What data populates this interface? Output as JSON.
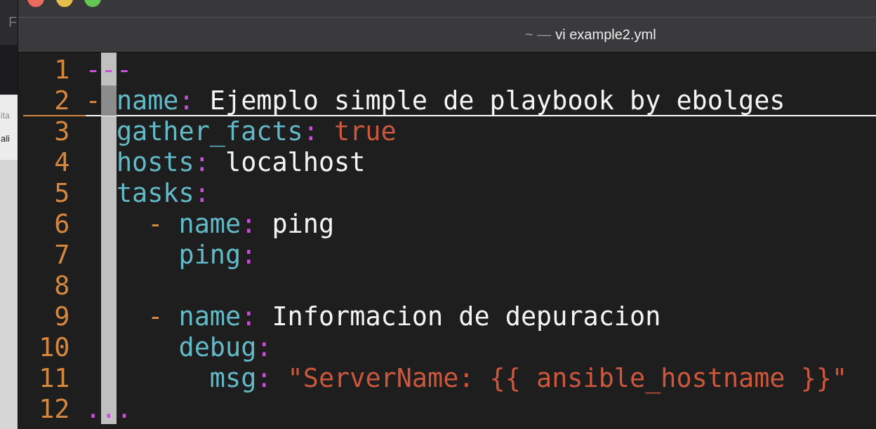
{
  "background_window": {
    "texts": [
      {
        "text": "F",
        "kind": "faint"
      },
      {
        "text": "ita",
        "kind": "faint"
      },
      {
        "text": "ali",
        "kind": "dark"
      }
    ]
  },
  "window": {
    "title_prefix": "~ —",
    "title": "vi example2.yml"
  },
  "editor": {
    "lines": [
      {
        "number": "1",
        "current": false,
        "tokens": [
          {
            "text": "---",
            "kind": "marker"
          }
        ]
      },
      {
        "number": "2",
        "current": true,
        "tokens": [
          {
            "text": "-",
            "kind": "dash"
          },
          {
            "text": " name",
            "kind": "key"
          },
          {
            "text": ":",
            "kind": "colon"
          },
          {
            "text": " Ejemplo simple de playbook by ebolges",
            "kind": "plain"
          }
        ]
      },
      {
        "number": "3",
        "current": false,
        "tokens": [
          {
            "text": "  gather_facts",
            "kind": "key"
          },
          {
            "text": ":",
            "kind": "colon"
          },
          {
            "text": " true",
            "kind": "bool"
          }
        ]
      },
      {
        "number": "4",
        "current": false,
        "tokens": [
          {
            "text": "  hosts",
            "kind": "key"
          },
          {
            "text": ":",
            "kind": "colon"
          },
          {
            "text": " localhost",
            "kind": "plain"
          }
        ]
      },
      {
        "number": "5",
        "current": false,
        "tokens": [
          {
            "text": "  tasks",
            "kind": "key"
          },
          {
            "text": ":",
            "kind": "colon"
          }
        ]
      },
      {
        "number": "6",
        "current": false,
        "tokens": [
          {
            "text": "    -",
            "kind": "dash"
          },
          {
            "text": " name",
            "kind": "key"
          },
          {
            "text": ":",
            "kind": "colon"
          },
          {
            "text": " ping",
            "kind": "plain"
          }
        ]
      },
      {
        "number": "7",
        "current": false,
        "tokens": [
          {
            "text": "      ping",
            "kind": "key"
          },
          {
            "text": ":",
            "kind": "colon"
          }
        ]
      },
      {
        "number": "8",
        "current": false
      },
      {
        "number": "9",
        "current": false,
        "tokens": [
          {
            "text": "    -",
            "kind": "dash"
          },
          {
            "text": " name",
            "kind": "key"
          },
          {
            "text": ":",
            "kind": "colon"
          },
          {
            "text": " Informacion de depuracion",
            "kind": "plain"
          }
        ]
      },
      {
        "number": "10",
        "current": false,
        "tokens": [
          {
            "text": "      debug",
            "kind": "key"
          },
          {
            "text": ":",
            "kind": "colon"
          }
        ]
      },
      {
        "number": "11",
        "current": false,
        "tokens": [
          {
            "text": "        msg",
            "kind": "key"
          },
          {
            "text": ":",
            "kind": "colon"
          },
          {
            "text": " \"ServerName: {{ ansible_hostname }}\"",
            "kind": "string"
          }
        ]
      },
      {
        "number": "12",
        "current": false,
        "tokens": [
          {
            "text": "...",
            "kind": "marker"
          }
        ]
      }
    ]
  }
}
